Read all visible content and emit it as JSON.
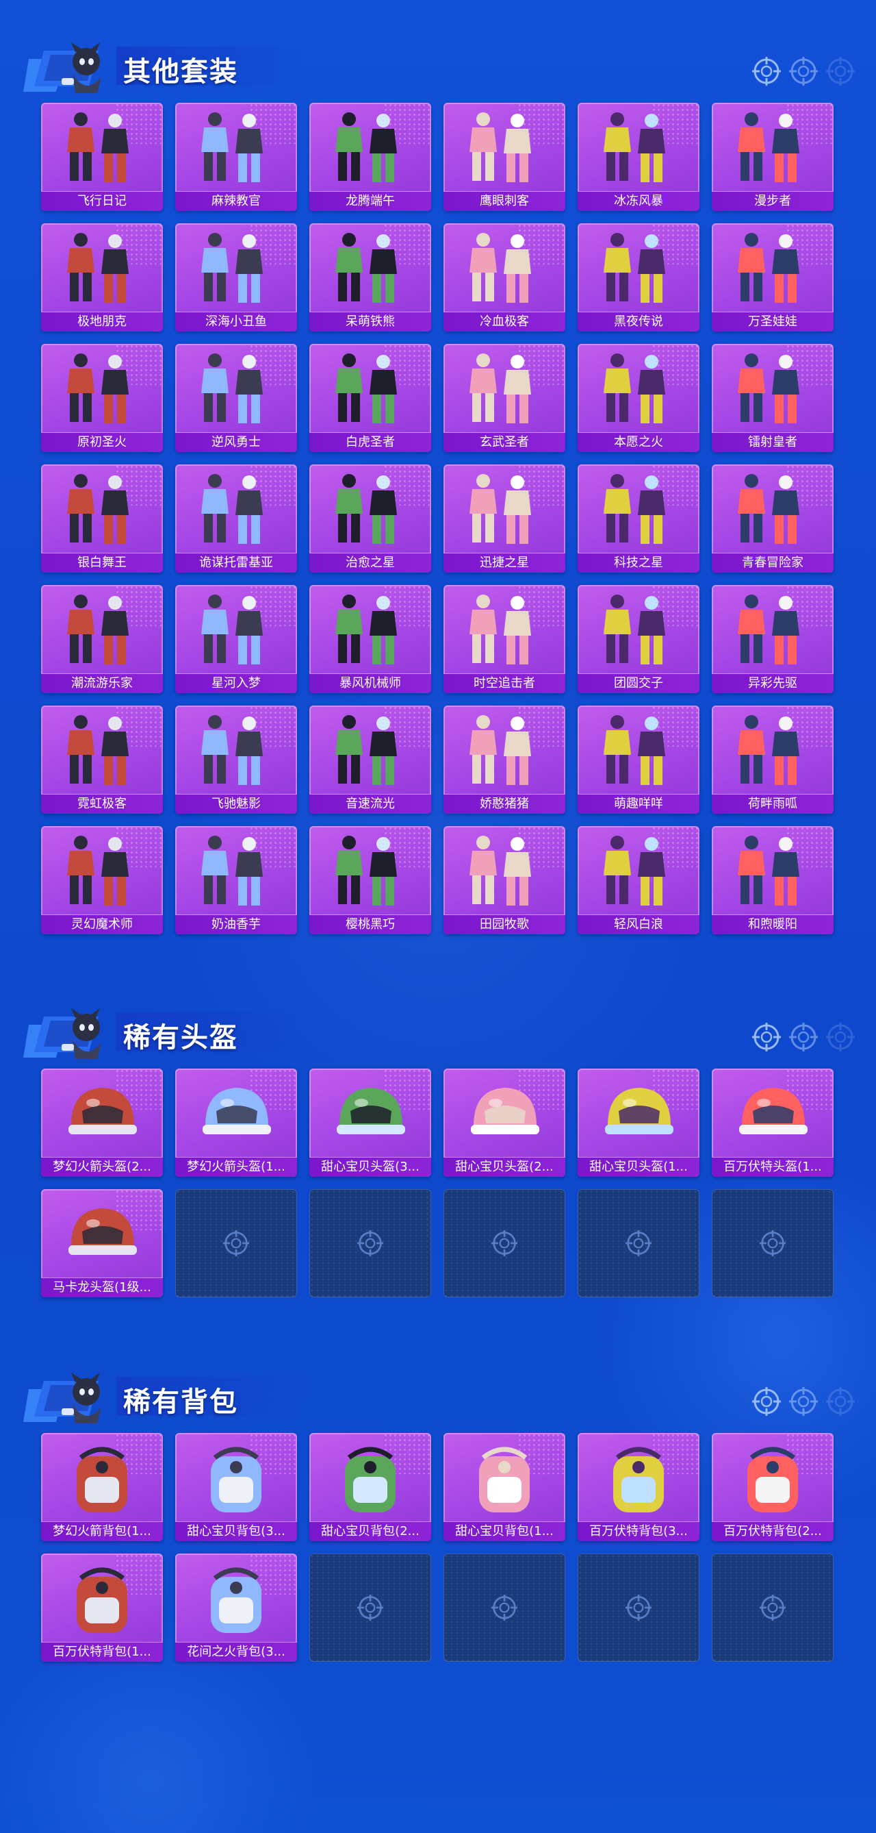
{
  "sections": [
    {
      "title": "其他套装",
      "items": [
        "飞行日记",
        "麻辣教官",
        "龙腾端午",
        "鹰眼刺客",
        "冰冻风暴",
        "漫步者",
        "极地朋克",
        "深海小丑鱼",
        "呆萌铁熊",
        "冷血极客",
        "黑夜传说",
        "万圣娃娃",
        "原初圣火",
        "逆风勇士",
        "白虎圣者",
        "玄武圣者",
        "本愿之火",
        "镭射皇者",
        "银白舞王",
        "诡谋托雷基亚",
        "治愈之星",
        "迅捷之星",
        "科技之星",
        "青春冒险家",
        "潮流游乐家",
        "星河入梦",
        "暴风机械师",
        "时空追击者",
        "团圆交子",
        "异彩先驱",
        "霓虹极客",
        "飞驰魅影",
        "音速流光",
        "娇憨猪猪",
        "萌趣咩咩",
        "荷畔雨呱",
        "灵幻魔术师",
        "奶油香芋",
        "樱桃黑巧",
        "田园牧歌",
        "轻风白浪",
        "和煦暖阳"
      ]
    },
    {
      "title": "稀有头盔",
      "items": [
        "梦幻火箭头盔(2...",
        "梦幻火箭头盔(1...",
        "甜心宝贝头盔(3...",
        "甜心宝贝头盔(2...",
        "甜心宝贝头盔(1...",
        "百万伏特头盔(1...",
        "马卡龙头盔(1级..."
      ],
      "empty_slots": 5
    },
    {
      "title": "稀有背包",
      "items": [
        "梦幻火箭背包(1...",
        "甜心宝贝背包(3...",
        "甜心宝贝背包(2...",
        "甜心宝贝背包(1...",
        "百万伏特背包(3...",
        "百万伏特背包(2...",
        "百万伏特背包(1...",
        "花间之火背包(3..."
      ],
      "empty_slots": 4
    }
  ],
  "colors": {
    "background": "#1250d8",
    "card": "#a446e6",
    "label_bar": "#7a16cc",
    "empty_slot": "#1b3b7a"
  },
  "icons": {
    "section_emblem": "character-emblem-icon",
    "header_decor": "crosshair-icon",
    "empty_slot": "crosshair-icon"
  }
}
